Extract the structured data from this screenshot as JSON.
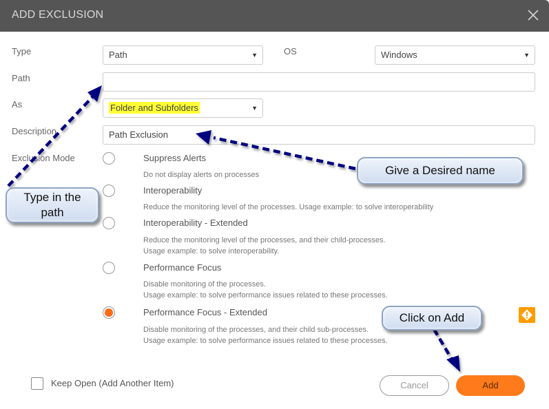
{
  "dialog": {
    "title": "ADD EXCLUSION",
    "close_icon": "close-icon"
  },
  "form": {
    "type_label": "Type",
    "type_value": "Path",
    "os_label": "OS",
    "os_value": "Windows",
    "path_label": "Path",
    "path_value": "",
    "as_label": "As",
    "as_value": "Folder and Subfolders",
    "description_label": "Description",
    "description_value": "Path Exclusion",
    "mode_label": "Exclusion Mode"
  },
  "modes": [
    {
      "title": "Suppress Alerts",
      "desc": [
        "Do not display alerts on processes"
      ],
      "checked": false
    },
    {
      "title": "Interoperability",
      "desc": [
        "Reduce the monitoring level of the processes. Usage example: to solve interoperability"
      ],
      "checked": false
    },
    {
      "title": "Interoperability - Extended",
      "desc": [
        "Reduce the monitoring level of the processes, and their child-processes.",
        "Usage example: to solve interoperability."
      ],
      "checked": false
    },
    {
      "title": "Performance Focus",
      "desc": [
        "Disable monitoring of the processes.",
        "Usage example: to solve performance issues related to these processes."
      ],
      "checked": false
    },
    {
      "title": "Performance Focus - Extended",
      "desc": [
        "Disable monitoring of the processes, and their child sub-processes.",
        "Usage example: to solve performance issues related to these processes."
      ],
      "checked": true
    }
  ],
  "footer": {
    "keep_open_label": "Keep Open (Add Another Item)",
    "keep_open_checked": false,
    "cancel_label": "Cancel",
    "add_label": "Add"
  },
  "annotations": {
    "type_path": [
      "Type in the",
      "path"
    ],
    "desired_name": "Give a Desired name",
    "click_add": "Click on Add"
  },
  "colors": {
    "accent": "#ff7a1a",
    "titlebar": "#555555",
    "warning": "#ff9c00",
    "arrow": "#000080",
    "highlight": "#ffff33"
  }
}
